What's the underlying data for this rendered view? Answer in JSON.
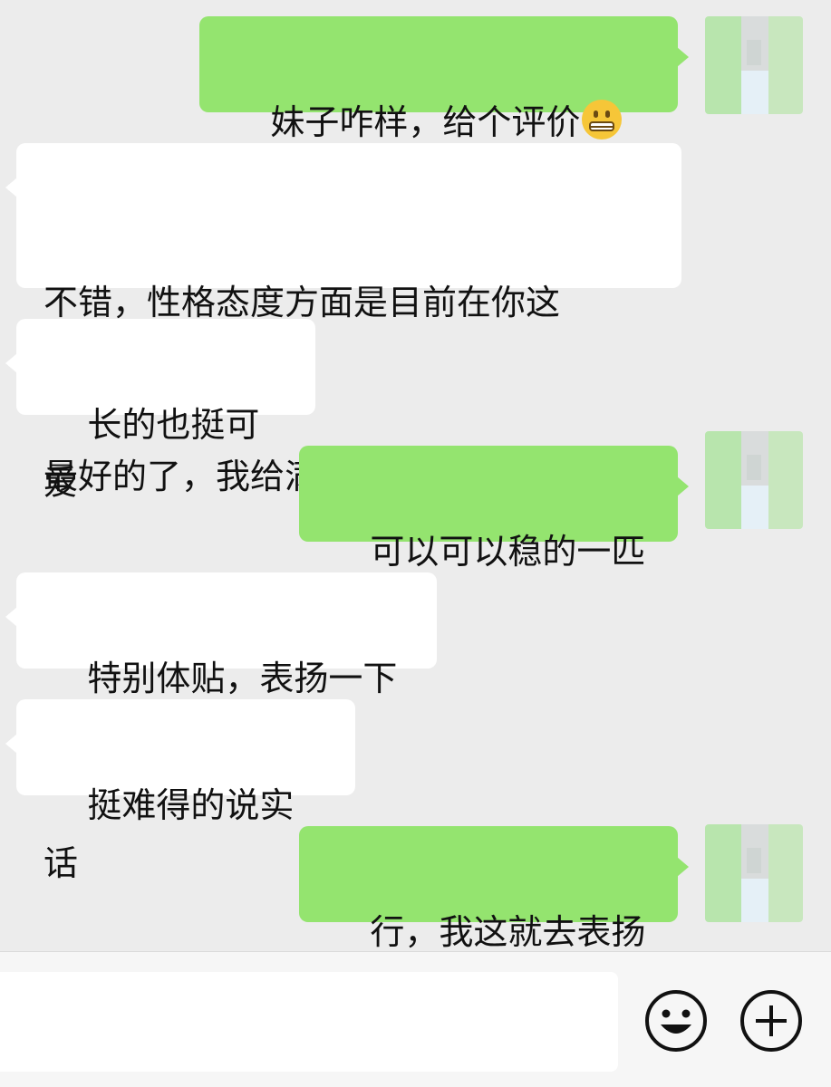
{
  "messages": [
    {
      "direction": "outgoing",
      "text": "妹子咋样，给个评价",
      "emoji": "grimacing-face-emoji"
    },
    {
      "direction": "incoming",
      "lines": [
        "不错，性格态度方面是目前在你这",
        "最好的了，我给满分。"
      ]
    },
    {
      "direction": "incoming",
      "text": "长的也挺可爱"
    },
    {
      "direction": "outgoing",
      "text": "可以可以稳的一匹"
    },
    {
      "direction": "incoming",
      "text": "特别体贴，表扬一下"
    },
    {
      "direction": "incoming",
      "text": "挺难得的说实话"
    },
    {
      "direction": "outgoing",
      "text": "行，我这就去表扬"
    }
  ],
  "input_bar": {
    "input_value": "",
    "emoji_button_icon": "smiley-face-icon",
    "more_button_icon": "plus-circle-icon"
  },
  "colors": {
    "outgoing_bubble": "#94e46f",
    "incoming_bubble": "#ffffff",
    "background": "#ececec",
    "input_bar": "#f6f6f6"
  }
}
